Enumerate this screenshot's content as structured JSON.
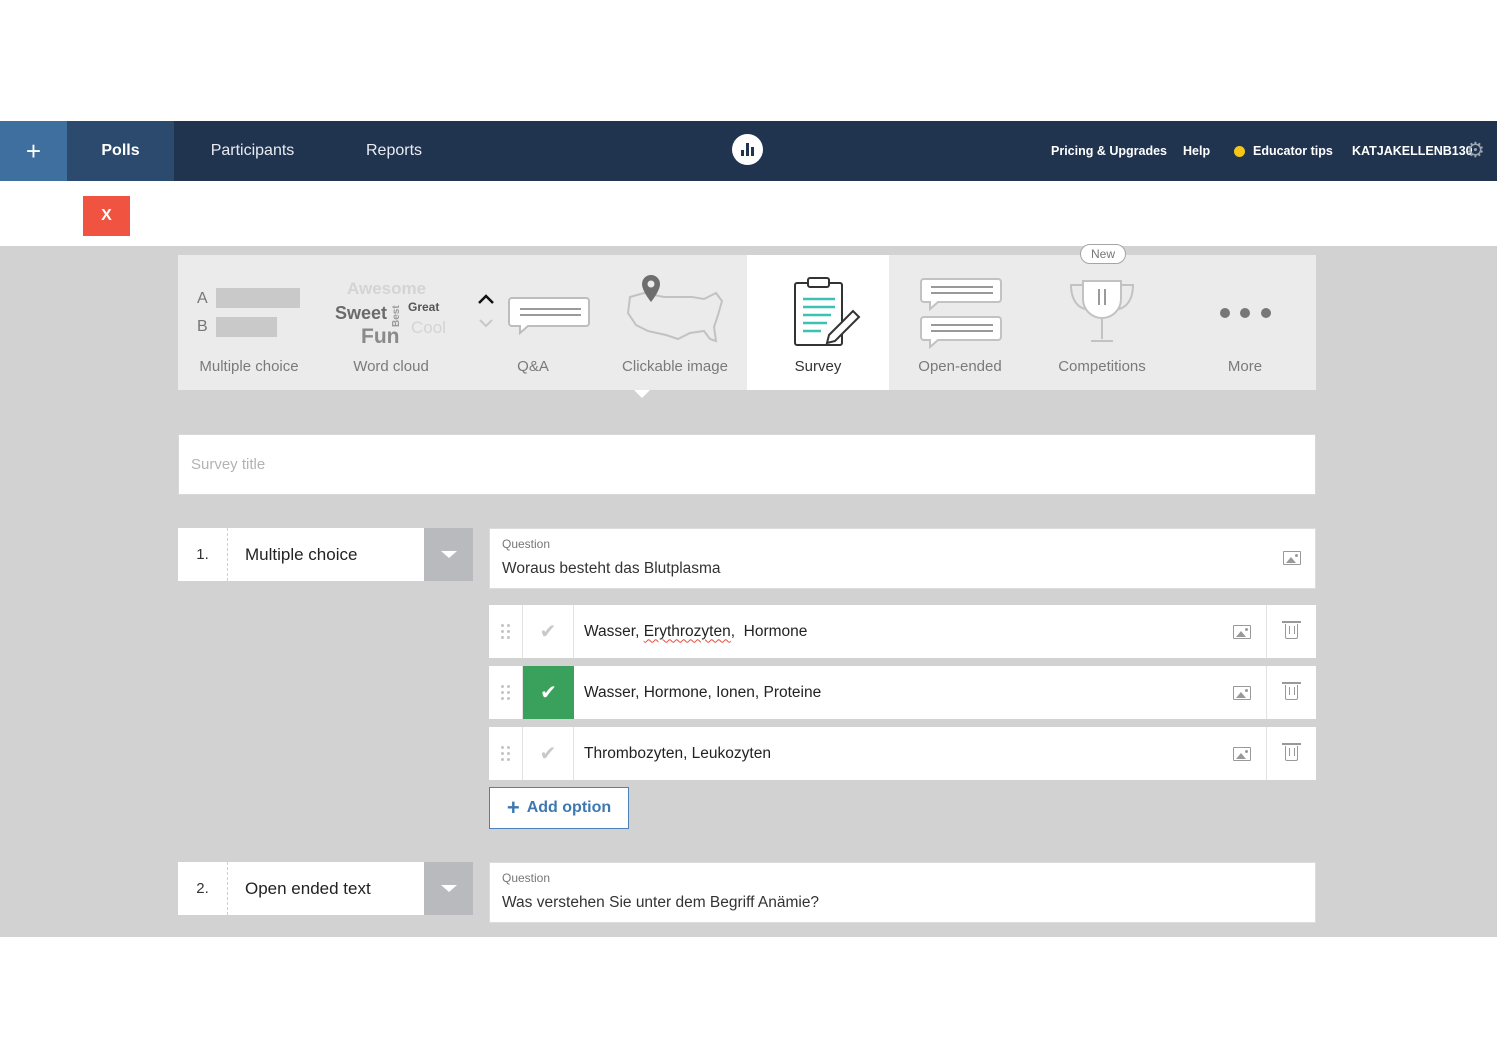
{
  "nav": {
    "plus": "+",
    "tabs": [
      "Polls",
      "Participants",
      "Reports"
    ],
    "pricing": "Pricing & Upgrades",
    "help": "Help",
    "educator_tips": "Educator tips",
    "username": "KATJAKELLENB130",
    "settings_icon": "gear-icon",
    "accent_active": "#2c4a6d",
    "plus_bg": "#3f6f9e"
  },
  "close_label": "X",
  "types": {
    "items": [
      "Multiple choice",
      "Word cloud",
      "Q&A",
      "Clickable image",
      "Survey",
      "Open-ended",
      "Competitions",
      "More"
    ],
    "active": "Survey",
    "new_badge": "New",
    "mc_letters": [
      "A",
      "B"
    ],
    "cloud_words": [
      "Awesome",
      "Sweet",
      "Best",
      "Great",
      "Fun",
      "Cool"
    ]
  },
  "survey": {
    "title_placeholder": "Survey title"
  },
  "questions": [
    {
      "number": "1.",
      "type": "Multiple choice",
      "caption": "Question",
      "text": "Woraus besteht das Blutplasma",
      "options": [
        {
          "parts": [
            "Wasser, ",
            "Erythrozyten",
            ",  Hormone"
          ],
          "correct": false
        },
        {
          "text": "Wasser, Hormone, Ionen, Proteine",
          "correct": true
        },
        {
          "text": "Thrombozyten, Leukozyten",
          "correct": false
        }
      ],
      "add_option": "Add option"
    },
    {
      "number": "2.",
      "type": "Open ended text",
      "caption": "Question",
      "text": "Was verstehen Sie unter dem Begriff Anämie?"
    }
  ],
  "colors": {
    "correct": "#3aa15c",
    "close": "#f0533f",
    "nav_bg": "#21344f",
    "survey_accent": "#3ec1b5"
  }
}
